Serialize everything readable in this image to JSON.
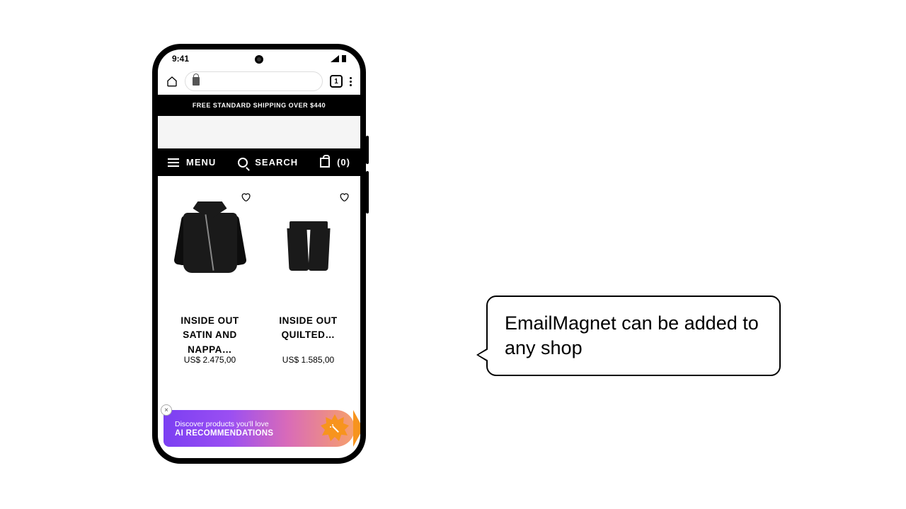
{
  "status": {
    "time": "9:41",
    "tab_count": "1"
  },
  "banner": "FREE STANDARD SHIPPING OVER $440",
  "nav": {
    "menu": "MENU",
    "search": "SEARCH",
    "cart_count": "(0)"
  },
  "products": [
    {
      "title": "INSIDE OUT SATIN AND NAPPA…",
      "price": "US$ 2.475,00"
    },
    {
      "title": "INSIDE OUT QUILTED…",
      "price": "US$ 1.585,00"
    }
  ],
  "widget": {
    "sub": "Discover products you'll love",
    "main": "AI RECOMMENDATIONS",
    "close": "×"
  },
  "callout": "EmailMagnet can be added to any shop"
}
